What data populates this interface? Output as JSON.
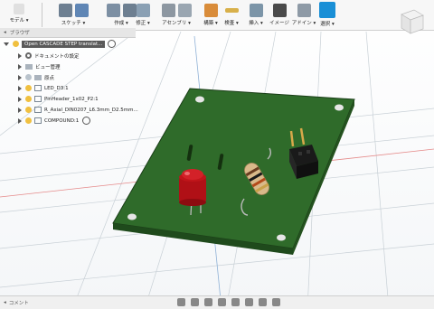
{
  "toolbar": {
    "workspace": "モデル ▾",
    "groups": [
      {
        "label": "スケッチ ▾"
      },
      {
        "label": "作成 ▾"
      },
      {
        "label": "修正 ▾"
      },
      {
        "label": "アセンブリ ▾"
      },
      {
        "label": "構築 ▾"
      },
      {
        "label": "検査 ▾"
      },
      {
        "label": "挿入 ▾"
      },
      {
        "label": "イメージ"
      },
      {
        "label": "アドイン ▾"
      },
      {
        "label": "選択 ▾"
      }
    ]
  },
  "browser": {
    "title": "ブラウザ",
    "root": "Open CASCADE STEP translat...",
    "items": [
      {
        "label": "ドキュメントの設定"
      },
      {
        "label": "ビュー管理"
      },
      {
        "label": "原点"
      },
      {
        "label": "LED_D3:1"
      },
      {
        "label": "PinHeader_1x02_P2:1"
      },
      {
        "label": "R_Axial_DIN0207_L6.3mm_D2.5mm..."
      },
      {
        "label": "COMPOUND:1"
      }
    ]
  },
  "comments": {
    "label": "コメント"
  },
  "colors": {
    "pcb": "#2f6b2a",
    "pcb_dark": "#1f4a1c",
    "led": "#c0151a",
    "resistor": "#d9b98a",
    "header": "#1a1a1a",
    "pins": "#d7a84a",
    "select_accent": "#1a8fd6"
  }
}
